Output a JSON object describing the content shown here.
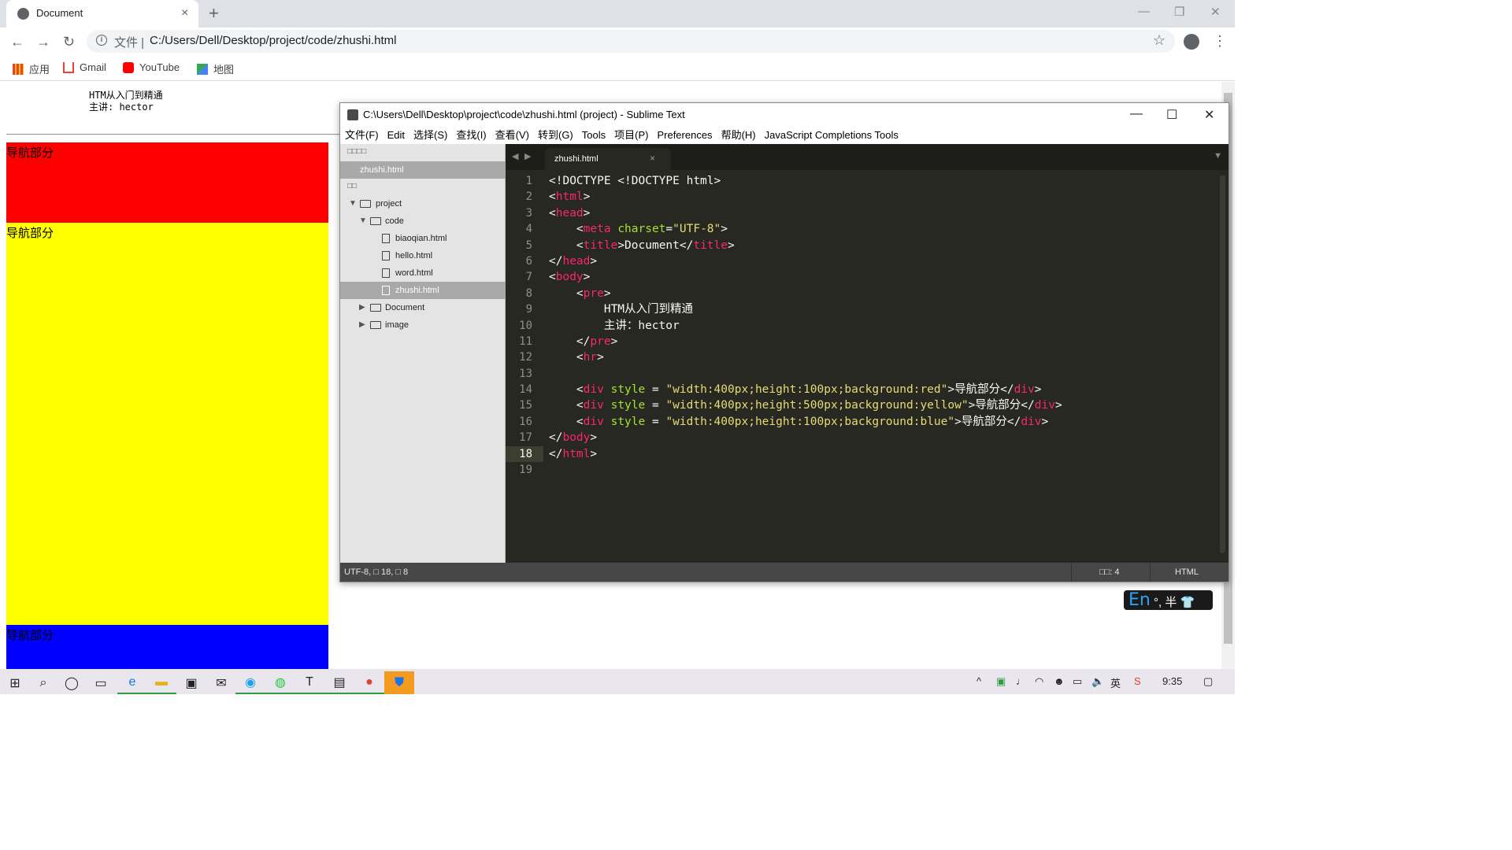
{
  "browser": {
    "tab_title": "Document",
    "tab_close": "×",
    "new_tab": "+",
    "window_controls": [
      "—",
      "❐",
      "✕"
    ],
    "nav": {
      "back": "←",
      "forward": "→",
      "reload": "↻"
    },
    "address": {
      "scheme_label": "文件 |",
      "url": "C:/Users/Dell/Desktop/project/code/zhushi.html"
    },
    "bookmarks": [
      {
        "label": "应用",
        "icon": "apps-grid-icon"
      },
      {
        "label": "Gmail",
        "icon": "gmail-icon"
      },
      {
        "label": "YouTube",
        "icon": "youtube-icon"
      },
      {
        "label": "地图",
        "icon": "maps-icon"
      }
    ]
  },
  "page": {
    "pre_line1": "HTM从入门到精通",
    "pre_line2": "主讲: hector",
    "divs": [
      {
        "label": "导航部分",
        "color": "#ff0000"
      },
      {
        "label": "导航部分",
        "color": "#ffff00"
      },
      {
        "label": "导航部分",
        "color": "#0000ff"
      }
    ]
  },
  "sublime": {
    "title": "C:\\Users\\Dell\\Desktop\\project\\code\\zhushi.html (project) - Sublime Text",
    "window_controls": [
      "—",
      "☐",
      "✕"
    ],
    "menu": [
      "文件(F)",
      "Edit",
      "选择(S)",
      "查找(I)",
      "查看(V)",
      "转到(G)",
      "Tools",
      "项目(P)",
      "Preferences",
      "帮助(H)",
      "JavaScript Completions Tools"
    ],
    "sidebar": {
      "open_files_header": "□□□□",
      "open_file": "zhushi.html",
      "folders_header": "□□",
      "tree": [
        {
          "label": "project",
          "depth": 0,
          "kind": "folder-open"
        },
        {
          "label": "code",
          "depth": 1,
          "kind": "folder-open"
        },
        {
          "label": "biaoqian.html",
          "depth": 2,
          "kind": "file"
        },
        {
          "label": "hello.html",
          "depth": 2,
          "kind": "file"
        },
        {
          "label": "word.html",
          "depth": 2,
          "kind": "file"
        },
        {
          "label": "zhushi.html",
          "depth": 2,
          "kind": "file",
          "selected": true
        },
        {
          "label": "Document",
          "depth": 1,
          "kind": "folder"
        },
        {
          "label": "image",
          "depth": 1,
          "kind": "folder"
        }
      ]
    },
    "editor": {
      "tab_name": "zhushi.html",
      "tab_close": "×",
      "current_line": 18,
      "lines": [
        "1",
        "2",
        "3",
        "4",
        "5",
        "6",
        "7",
        "8",
        "9",
        "10",
        "11",
        "12",
        "13",
        "14",
        "15",
        "16",
        "17",
        "18",
        "19"
      ],
      "code_text": {
        "l9": "HTM从入门到精通",
        "l10": "主讲：hector",
        "l14_style": "\"width:400px;height:100px;background:red\"",
        "l15_style": "\"width:400px;height:500px;background:yellow\"",
        "l16_style": "\"width:400px;height:100px;background:blue\"",
        "div_text": "导航部分"
      }
    },
    "status": {
      "left": "UTF-8, □ 18, □ 8",
      "indent": "□□: 4",
      "syntax": "HTML"
    }
  },
  "ime": {
    "en": "En",
    "rest": "°, 半 👕"
  },
  "taskbar": {
    "clock": "9:35",
    "items": [
      "windows-start-icon",
      "search-icon",
      "cortana-icon",
      "task-view-icon",
      "edge-icon",
      "file-explorer-icon",
      "store-icon",
      "mail-icon",
      "qq-icon",
      "wechat-icon",
      "typora-icon",
      "sublime-icon",
      "chrome-icon",
      "security-icon"
    ]
  }
}
